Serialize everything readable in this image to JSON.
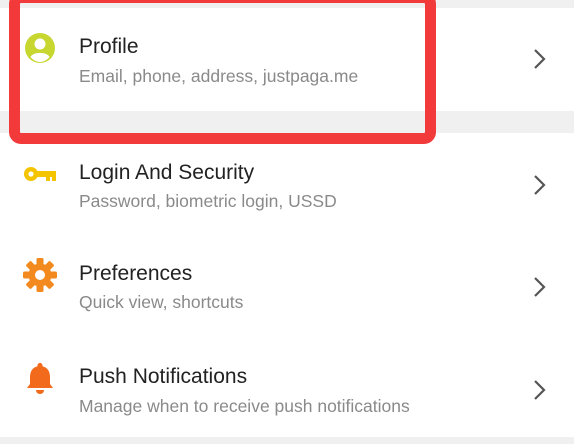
{
  "settings": {
    "items": [
      {
        "title": "Profile",
        "subtitle": "Email, phone, address, justpaga.me",
        "icon": "person-circle-icon",
        "icon_color": "#c8d630"
      },
      {
        "title": "Login And Security",
        "subtitle": "Password, biometric login, USSD",
        "icon": "key-icon",
        "icon_color": "#f5c400"
      },
      {
        "title": "Preferences",
        "subtitle": "Quick view, shortcuts",
        "icon": "gear-icon",
        "icon_color": "#f28a1f"
      },
      {
        "title": "Push Notifications",
        "subtitle": "Manage when to receive push notifications",
        "icon": "bell-icon",
        "icon_color": "#f26b1d"
      }
    ]
  },
  "colors": {
    "highlight_border": "#f23a3a",
    "chevron": "#555555",
    "background": "#f0f0f0",
    "card": "#ffffff"
  }
}
